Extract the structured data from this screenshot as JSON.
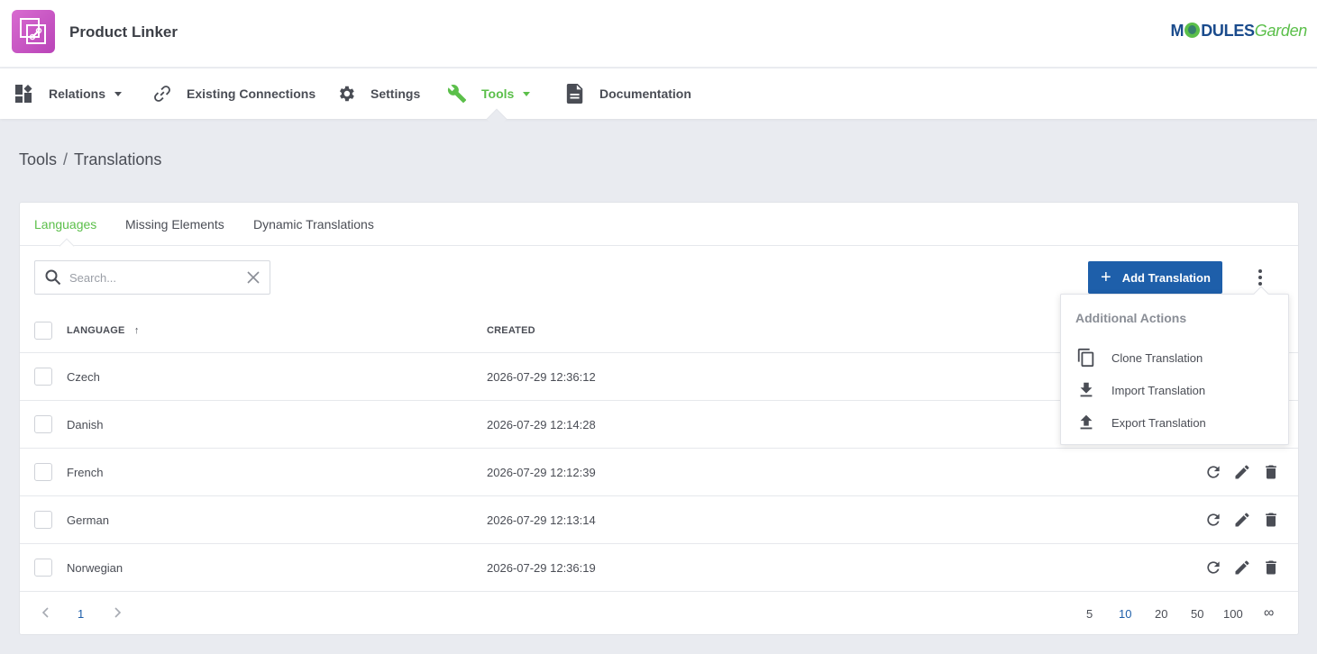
{
  "app": {
    "title": "Product Linker",
    "brand_prefix": "M",
    "brand_middle": "DULES",
    "brand_suffix": "Garden"
  },
  "nav": {
    "items": [
      {
        "label": "Relations",
        "icon": "dashboard-icon",
        "dropdown": true
      },
      {
        "label": "Existing Connections",
        "icon": "link-icon",
        "dropdown": false
      },
      {
        "label": "Settings",
        "icon": "gear-icon",
        "dropdown": false
      },
      {
        "label": "Tools",
        "icon": "wrench-icon",
        "dropdown": true,
        "active": true
      },
      {
        "label": "Documentation",
        "icon": "document-icon",
        "dropdown": false
      }
    ]
  },
  "breadcrumb": {
    "parent": "Tools",
    "separator": "/",
    "current": "Translations"
  },
  "tabs": [
    {
      "label": "Languages",
      "active": true
    },
    {
      "label": "Missing Elements"
    },
    {
      "label": "Dynamic Translations"
    }
  ],
  "search": {
    "placeholder": "Search...",
    "value": ""
  },
  "toolbar": {
    "add_label": "Add Translation"
  },
  "table": {
    "columns": [
      "Language",
      "Created"
    ],
    "sort_indicator": "↑",
    "rows": [
      {
        "language": "Czech",
        "created": "2026-07-29 12:36:12"
      },
      {
        "language": "Danish",
        "created": "2026-07-29 12:14:28"
      },
      {
        "language": "French",
        "created": "2026-07-29 12:12:39"
      },
      {
        "language": "German",
        "created": "2026-07-29 12:13:14"
      },
      {
        "language": "Norwegian",
        "created": "2026-07-29 12:36:19"
      }
    ]
  },
  "pagination": {
    "current_page": "1",
    "page_sizes": [
      "5",
      "10",
      "20",
      "50",
      "100",
      "∞"
    ],
    "active_size": "10"
  },
  "dropdown": {
    "title": "Additional Actions",
    "items": [
      {
        "label": "Clone Translation",
        "icon": "copy-icon"
      },
      {
        "label": "Import Translation",
        "icon": "download-icon"
      },
      {
        "label": "Export Translation",
        "icon": "upload-icon"
      }
    ]
  },
  "colors": {
    "accent_green": "#5bbf4a",
    "primary_blue": "#1e5faa",
    "logo_pink": "#c955c6"
  }
}
